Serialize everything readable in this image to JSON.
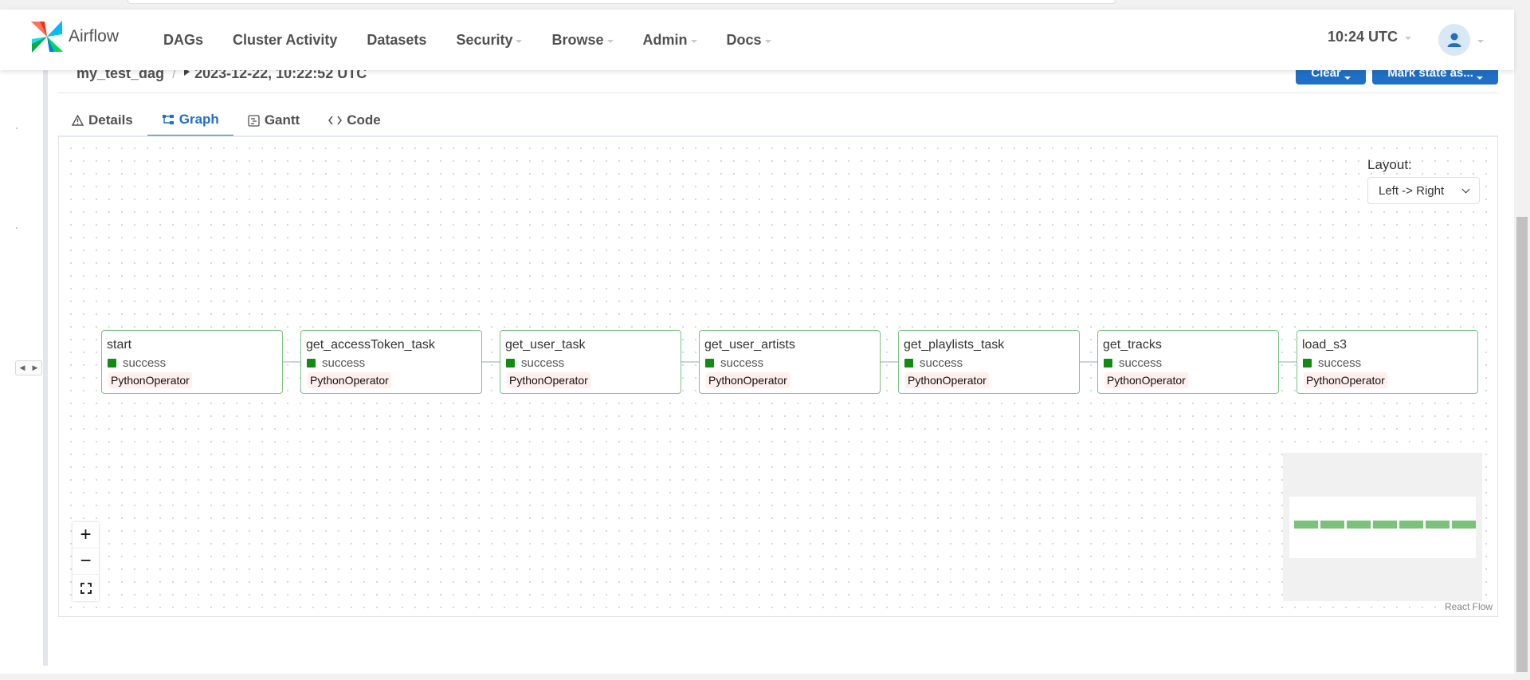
{
  "app": {
    "brand": "Airflow"
  },
  "nav": {
    "items": [
      {
        "label": "DAGs",
        "dropdown": false
      },
      {
        "label": "Cluster Activity",
        "dropdown": false
      },
      {
        "label": "Datasets",
        "dropdown": false
      },
      {
        "label": "Security",
        "dropdown": true
      },
      {
        "label": "Browse",
        "dropdown": true
      },
      {
        "label": "Admin",
        "dropdown": true
      },
      {
        "label": "Docs",
        "dropdown": true
      }
    ],
    "clock": "10:24 UTC"
  },
  "breadcrumb": {
    "dag": "my_test_dag",
    "separator": "/",
    "run": "2023-12-22, 10:22:52 UTC"
  },
  "actions": {
    "clear": "Clear",
    "mark_state": "Mark state as..."
  },
  "tabs": [
    {
      "label": "Details",
      "icon": "warning-triangle-icon",
      "active": false
    },
    {
      "label": "Graph",
      "icon": "graph-icon",
      "active": true
    },
    {
      "label": "Gantt",
      "icon": "gantt-icon",
      "active": false
    },
    {
      "label": "Code",
      "icon": "code-icon",
      "active": false
    }
  ],
  "graph": {
    "layout_label": "Layout:",
    "layout_value": "Left -> Right",
    "nodes": [
      {
        "name": "start",
        "state": "success",
        "operator": "PythonOperator"
      },
      {
        "name": "get_accessToken_task",
        "state": "success",
        "operator": "PythonOperator"
      },
      {
        "name": "get_user_task",
        "state": "success",
        "operator": "PythonOperator"
      },
      {
        "name": "get_user_artists",
        "state": "success",
        "operator": "PythonOperator"
      },
      {
        "name": "get_playlists_task",
        "state": "success",
        "operator": "PythonOperator"
      },
      {
        "name": "get_tracks",
        "state": "success",
        "operator": "PythonOperator"
      },
      {
        "name": "load_s3",
        "state": "success",
        "operator": "PythonOperator"
      }
    ],
    "controls": {
      "zoom_in": "+",
      "zoom_out": "−",
      "fit": "⛶"
    },
    "attribution": "React Flow"
  },
  "colors": {
    "primary": "#1f6fc7",
    "success": "#128b12",
    "node_border": "#7bc384"
  }
}
